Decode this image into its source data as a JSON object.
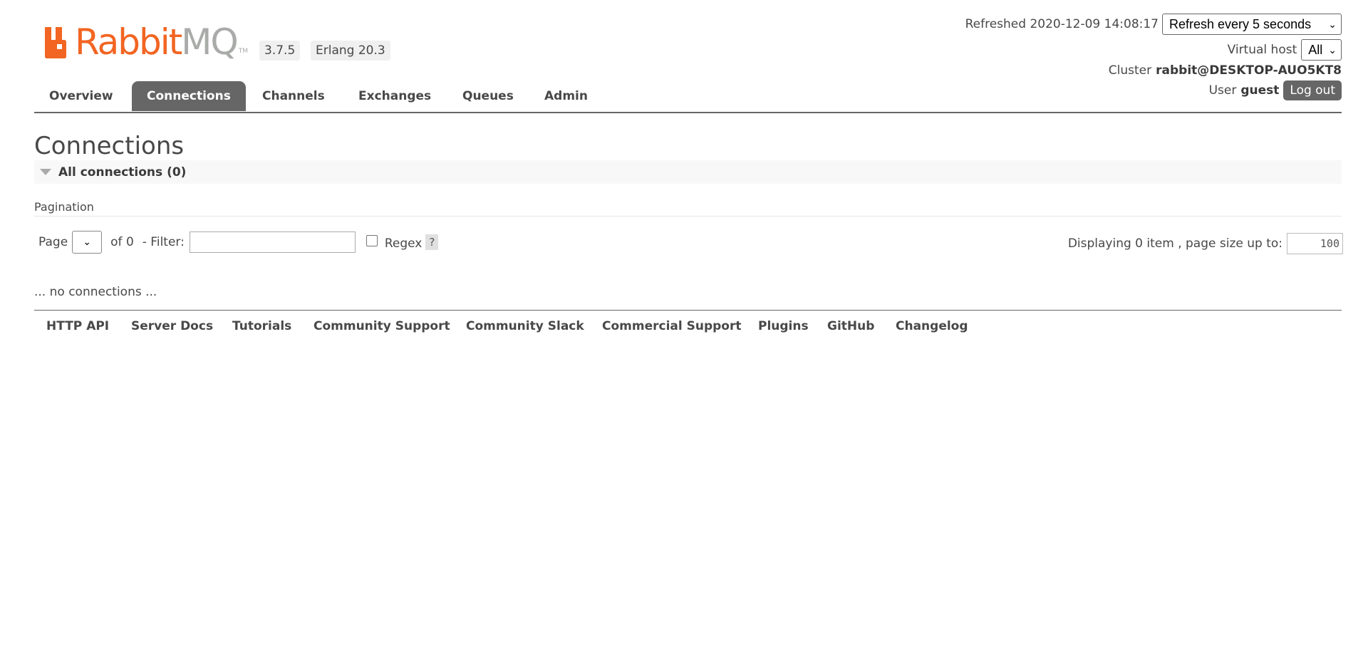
{
  "header": {
    "logo": {
      "brand_primary": "Rabbit",
      "brand_secondary": "MQ",
      "tm": "TM"
    },
    "version": "3.7.5",
    "erlang_version": "Erlang 20.3",
    "refreshed_label": "Refreshed 2020-12-09 14:08:17",
    "refresh_select": "Refresh every 5 seconds",
    "vhost_label": "Virtual host",
    "vhost_select": "All",
    "cluster_label": "Cluster",
    "cluster_name": "rabbit@DESKTOP-AUO5KT8",
    "user_label": "User",
    "user_name": "guest",
    "logout_label": "Log out"
  },
  "nav": {
    "tabs": [
      {
        "label": "Overview",
        "active": false
      },
      {
        "label": "Connections",
        "active": true
      },
      {
        "label": "Channels",
        "active": false
      },
      {
        "label": "Exchanges",
        "active": false
      },
      {
        "label": "Queues",
        "active": false
      },
      {
        "label": "Admin",
        "active": false
      }
    ]
  },
  "main": {
    "title": "Connections",
    "section_label": "All connections (0)",
    "pagination_label": "Pagination",
    "page_label": "Page",
    "of_label": "of 0",
    "filter_label": "- Filter:",
    "filter_value": "",
    "regex_label": "Regex",
    "regex_checked": false,
    "help_label": "?",
    "display_label": "Displaying 0 item , page size up to:",
    "page_size": "100",
    "empty_message": "... no connections ..."
  },
  "footer": {
    "links": [
      "HTTP API",
      "Server Docs",
      "Tutorials",
      "Community Support",
      "Community Slack",
      "Commercial Support",
      "Plugins",
      "GitHub",
      "Changelog"
    ]
  },
  "colors": {
    "brand_orange": "#f26522",
    "brand_grey": "#a9aba9",
    "nav_active_bg": "#666666",
    "text": "#484848"
  }
}
